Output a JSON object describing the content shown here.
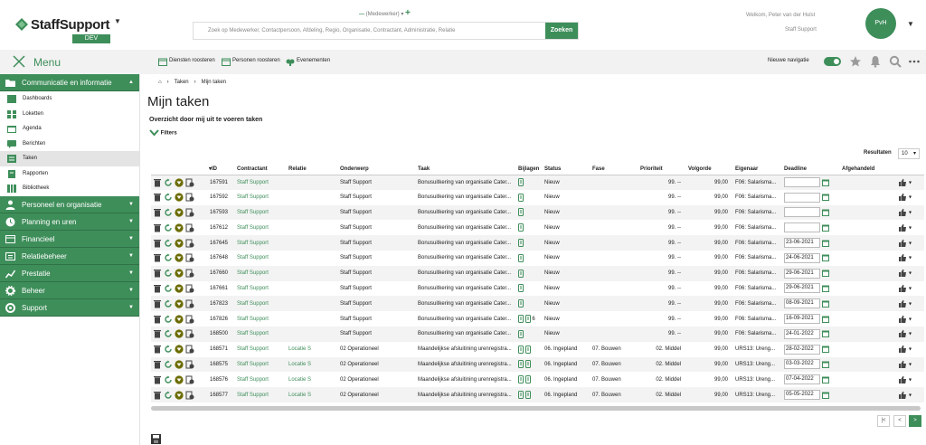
{
  "brand": {
    "name": "StaffSupport",
    "env": "DEV",
    "accent": "#3e8e5a"
  },
  "role": {
    "label": "(Medewerker)"
  },
  "search": {
    "placeholder": "Zoek op Medewerker, Contactpersoon, Afdeling, Regio, Organisatie, Contractant, Administratie, Relatie",
    "button": "Zoeken"
  },
  "user": {
    "welcome": "Welkom, Peter van der Hulst",
    "org": "Staff Support",
    "initials": "PvH"
  },
  "topbar": {
    "menu": "Menu",
    "links": [
      "Diensten roosteren",
      "Personen roosteren",
      "Evenementen"
    ],
    "new_nav": "Nieuwe navigatie",
    "new_nav_on": true,
    "icons": [
      "star-icon",
      "bell-icon",
      "search-icon",
      "more-icon"
    ]
  },
  "sidebar": {
    "sections": [
      {
        "label": "Communicatie en informatie",
        "icon": "folder-icon",
        "expanded": true,
        "items": [
          {
            "label": "Dashboards",
            "icon": "dashboard-icon"
          },
          {
            "label": "Loketten",
            "icon": "grid-icon"
          },
          {
            "label": "Agenda",
            "icon": "calendar-icon"
          },
          {
            "label": "Berichten",
            "icon": "chat-icon"
          },
          {
            "label": "Taken",
            "icon": "tasks-icon",
            "active": true
          },
          {
            "label": "Rapporten",
            "icon": "report-icon"
          },
          {
            "label": "Bibliotheek",
            "icon": "library-icon"
          }
        ]
      },
      {
        "label": "Personeel en organisatie",
        "icon": "people-icon"
      },
      {
        "label": "Planning en uren",
        "icon": "clock-icon"
      },
      {
        "label": "Financieel",
        "icon": "finance-icon"
      },
      {
        "label": "Relatiebeheer",
        "icon": "relation-icon"
      },
      {
        "label": "Prestatie",
        "icon": "chart-icon"
      },
      {
        "label": "Beheer",
        "icon": "gear-icon"
      },
      {
        "label": "Support",
        "icon": "support-icon"
      }
    ]
  },
  "breadcrumb": [
    "Taken",
    "Mijn taken"
  ],
  "page": {
    "title": "Mijn taken",
    "subtitle": "Overzicht door mij uit te voeren taken",
    "filters": "Filters"
  },
  "results": {
    "label": "Resultaten",
    "value": "10"
  },
  "table": {
    "columns": [
      "",
      "ID",
      "Contractant",
      "Relatie",
      "Onderwerp",
      "Taak",
      "Bijlagen",
      "Status",
      "Fase",
      "Prioriteit",
      "Volgorde",
      "Eigenaar",
      "Deadline",
      "Afgehandeld"
    ],
    "rows": [
      {
        "id": "167591",
        "contractant": "Staff Support",
        "relatie": "",
        "onderwerp": "Staff Support",
        "taak": "Bonusuitkering van organisatie Cater...",
        "bijlagen": "",
        "bijlagen_count": 1,
        "status": "Nieuw",
        "fase": "",
        "prioriteit": "99. --",
        "volgorde": "99,00",
        "eigenaar": "F06: Salarisma...",
        "deadline": ""
      },
      {
        "id": "167592",
        "contractant": "Staff Support",
        "relatie": "",
        "onderwerp": "Staff Support",
        "taak": "Bonusuitkering van organisatie Cater...",
        "bijlagen": "",
        "bijlagen_count": 1,
        "status": "Nieuw",
        "fase": "",
        "prioriteit": "99. --",
        "volgorde": "99,00",
        "eigenaar": "F06: Salarisma...",
        "deadline": ""
      },
      {
        "id": "167593",
        "contractant": "Staff Support",
        "relatie": "",
        "onderwerp": "Staff Support",
        "taak": "Bonusuitkering van organisatie Cater...",
        "bijlagen": "",
        "bijlagen_count": 1,
        "status": "Nieuw",
        "fase": "",
        "prioriteit": "99. --",
        "volgorde": "99,00",
        "eigenaar": "F06: Salarisma...",
        "deadline": ""
      },
      {
        "id": "167612",
        "contractant": "Staff Support",
        "relatie": "",
        "onderwerp": "Staff Support",
        "taak": "Bonusuitkering van organisatie Cater...",
        "bijlagen": "",
        "bijlagen_count": 1,
        "status": "Nieuw",
        "fase": "",
        "prioriteit": "99. --",
        "volgorde": "99,00",
        "eigenaar": "F06: Salarisma...",
        "deadline": ""
      },
      {
        "id": "167645",
        "contractant": "Staff Support",
        "relatie": "",
        "onderwerp": "Staff Support",
        "taak": "Bonusuitkering van organisatie Cater...",
        "bijlagen": "",
        "bijlagen_count": 1,
        "status": "Nieuw",
        "fase": "",
        "prioriteit": "99. --",
        "volgorde": "99,00",
        "eigenaar": "F06: Salarisma...",
        "deadline": "23-06-2021"
      },
      {
        "id": "167648",
        "contractant": "Staff Support",
        "relatie": "",
        "onderwerp": "Staff Support",
        "taak": "Bonusuitkering van organisatie Cater...",
        "bijlagen": "",
        "bijlagen_count": 1,
        "status": "Nieuw",
        "fase": "",
        "prioriteit": "99. --",
        "volgorde": "99,00",
        "eigenaar": "F06: Salarisma...",
        "deadline": "24-06-2021"
      },
      {
        "id": "167660",
        "contractant": "Staff Support",
        "relatie": "",
        "onderwerp": "Staff Support",
        "taak": "Bonusuitkering van organisatie Cater...",
        "bijlagen": "",
        "bijlagen_count": 1,
        "status": "Nieuw",
        "fase": "",
        "prioriteit": "99. --",
        "volgorde": "99,00",
        "eigenaar": "F06: Salarisma...",
        "deadline": "29-06-2021"
      },
      {
        "id": "167661",
        "contractant": "Staff Support",
        "relatie": "",
        "onderwerp": "Staff Support",
        "taak": "Bonusuitkering van organisatie Cater...",
        "bijlagen": "",
        "bijlagen_count": 1,
        "status": "Nieuw",
        "fase": "",
        "prioriteit": "99. --",
        "volgorde": "99,00",
        "eigenaar": "F06: Salarisma...",
        "deadline": "29-06-2021"
      },
      {
        "id": "167823",
        "contractant": "Staff Support",
        "relatie": "",
        "onderwerp": "Staff Support",
        "taak": "Bonusuitkering van organisatie Cater...",
        "bijlagen": "",
        "bijlagen_count": 1,
        "status": "Nieuw",
        "fase": "",
        "prioriteit": "99. --",
        "volgorde": "99,00",
        "eigenaar": "F06: Salarisma...",
        "deadline": "08-09-2021"
      },
      {
        "id": "167826",
        "contractant": "Staff Support",
        "relatie": "",
        "onderwerp": "Staff Support",
        "taak": "Bonusuitkering van organisatie Cater...",
        "bijlagen": "6",
        "bijlagen_count": 2,
        "status": "Nieuw",
        "fase": "",
        "prioriteit": "99. --",
        "volgorde": "99,00",
        "eigenaar": "F06: Salarisma...",
        "deadline": "16-09-2021"
      },
      {
        "id": "168500",
        "contractant": "Staff Support",
        "relatie": "",
        "onderwerp": "Staff Support",
        "taak": "Bonusuitkering van organisatie Cater...",
        "bijlagen": "",
        "bijlagen_count": 1,
        "status": "Nieuw",
        "fase": "",
        "prioriteit": "99. --",
        "volgorde": "99,00",
        "eigenaar": "F06: Salarisma...",
        "deadline": "24-01-2022"
      },
      {
        "id": "168571",
        "contractant": "Staff Support",
        "relatie": "Locatie S",
        "onderwerp": "02 Operationeel",
        "taak": "Maandelijkse afsluitining urenregistra...",
        "bijlagen": "",
        "bijlagen_count": 2,
        "status": "06. Ingepland",
        "fase": "07. Bouwen",
        "prioriteit": "02. Middel",
        "volgorde": "99,00",
        "eigenaar": "URS13: Ureng...",
        "deadline": "28-02-2022"
      },
      {
        "id": "168575",
        "contractant": "Staff Support",
        "relatie": "Locatie S",
        "onderwerp": "02 Operationeel",
        "taak": "Maandelijkse afsluitining urenregistra...",
        "bijlagen": "",
        "bijlagen_count": 2,
        "status": "06. Ingepland",
        "fase": "07. Bouwen",
        "prioriteit": "02. Middel",
        "volgorde": "99,00",
        "eigenaar": "URS13: Ureng...",
        "deadline": "03-03-2022"
      },
      {
        "id": "168576",
        "contractant": "Staff Support",
        "relatie": "Locatie S",
        "onderwerp": "02 Operationeel",
        "taak": "Maandelijkse afsluitining urenregistra...",
        "bijlagen": "",
        "bijlagen_count": 2,
        "status": "06. Ingepland",
        "fase": "07. Bouwen",
        "prioriteit": "02. Middel",
        "volgorde": "99,00",
        "eigenaar": "URS13: Ureng...",
        "deadline": "07-04-2022"
      },
      {
        "id": "168577",
        "contractant": "Staff Support",
        "relatie": "Locatie S",
        "onderwerp": "02 Operationeel",
        "taak": "Maandelijkse afsluitining urenregistra...",
        "bijlagen": "",
        "bijlagen_count": 2,
        "status": "06. Ingepland",
        "fase": "07. Bouwen",
        "prioriteit": "02. Middel",
        "volgorde": "99,00",
        "eigenaar": "URS13: Ureng...",
        "deadline": "05-05-2022"
      }
    ]
  },
  "pagination": {
    "first": "|<",
    "prev": "<",
    "next": ">"
  }
}
